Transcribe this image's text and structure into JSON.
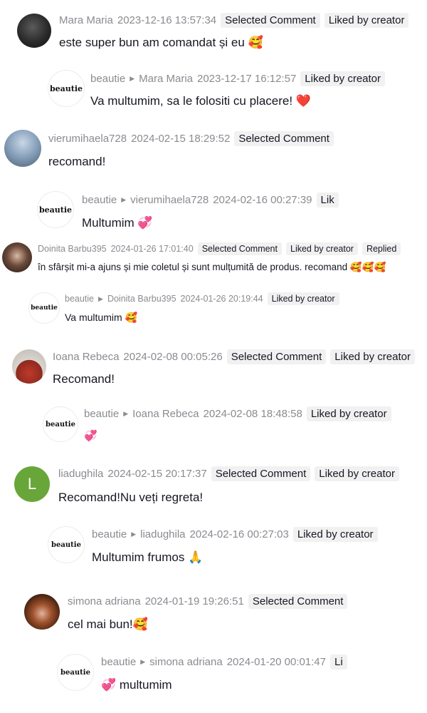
{
  "comments": [
    {
      "author": "Mara Maria",
      "date": "2023-12-16 13:57:34",
      "tags": [
        "Selected Comment",
        "Liked by creator"
      ],
      "text": "este super bun am comandat și eu 🥰",
      "reply": {
        "author": "beautie",
        "to": "Mara Maria",
        "date": "2023-12-17 16:12:57",
        "tags": [
          "Liked by creator"
        ],
        "text": "Va multumim, sa le folositi cu placere! ❤️"
      }
    },
    {
      "author": "vierumihaela728",
      "date": "2024-02-15 18:29:52",
      "tags": [
        "Selected Comment"
      ],
      "text": "recomand!",
      "reply": {
        "author": "beautie",
        "to": "vierumihaela728",
        "date": "2024-02-16 00:27:39",
        "tags": [
          "Lik"
        ],
        "text": "Multumim 💞"
      }
    },
    {
      "author": "Doinita Barbu395",
      "date": "2024-01-26 17:01:40",
      "tags": [
        "Selected Comment",
        "Liked by creator",
        "Replied"
      ],
      "text": "în sfârșit mi-a ajuns și mie coletul și sunt mulțumită de produs. recomand 🥰🥰🥰",
      "reply": {
        "author": "beautie",
        "to": "Doinita Barbu395",
        "date": "2024-01-26 20:19:44",
        "tags": [
          "Liked by creator"
        ],
        "text": "Va multumim 🥰"
      }
    },
    {
      "author": "Ioana Rebeca",
      "date": "2024-02-08 00:05:26",
      "tags": [
        "Selected Comment",
        "Liked by creator"
      ],
      "text": "Recomand!",
      "reply": {
        "author": "beautie",
        "to": "Ioana Rebeca",
        "date": "2024-02-08 18:48:58",
        "tags": [
          "Liked by creator"
        ],
        "text": "💞"
      }
    },
    {
      "author": "liadughila",
      "avatar_letter": "L",
      "date": "2024-02-15 20:17:37",
      "tags": [
        "Selected Comment",
        "Liked by creator"
      ],
      "text": "Recomand!Nu veți regreta!",
      "reply": {
        "author": "beautie",
        "to": "liadughila",
        "date": "2024-02-16 00:27:03",
        "tags": [
          "Liked by creator"
        ],
        "text": "Multumim frumos 🙏"
      }
    },
    {
      "author": "simona adriana",
      "date": "2024-01-19 19:26:51",
      "tags": [
        "Selected Comment"
      ],
      "text": "cel mai bun!🥰",
      "reply": {
        "author": "beautie",
        "to": "simona adriana",
        "date": "2024-01-20 00:01:47",
        "tags": [
          "Li"
        ],
        "text": "💞 multumim"
      }
    }
  ],
  "brand_logo_text": "beautie",
  "colors": {
    "meta": "#8a8b91",
    "tag_bg": "#f1f1f2",
    "text": "#161823",
    "letter_avatar": "#69a63a"
  }
}
